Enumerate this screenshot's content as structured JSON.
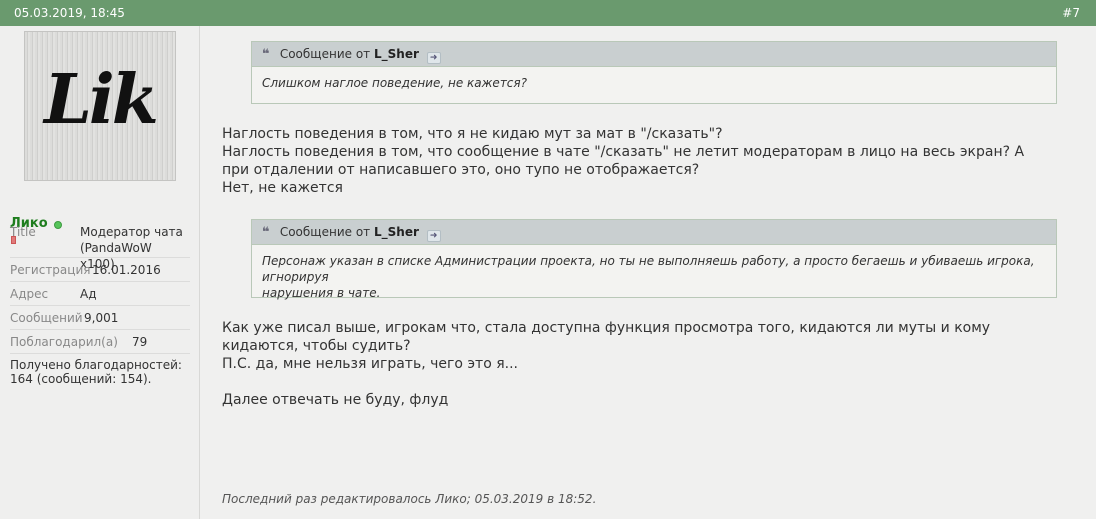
{
  "post": {
    "date": "05.03.2019, 18:45",
    "number": "#7"
  },
  "author": {
    "avatar_text": "Lik",
    "name": "Лико",
    "online": true,
    "title_label": "Title",
    "title_value_1": "Модератор чата",
    "title_value_2": "(PandaWoW x100)",
    "reg_label": "Регистрация",
    "reg_value": "16.01.2016",
    "addr_label": "Адрес",
    "addr_value": "Ад",
    "msgs_label": "Сообщений",
    "msgs_value": "9,001",
    "thanked_label": "Поблагодарил(а)",
    "thanked_value": "79",
    "thanks_line_1": "Получено благодарностей:",
    "thanks_line_2": "164 (сообщений: 154)."
  },
  "quote1": {
    "prefix": "Сообщение от",
    "author": "L_Sher",
    "text": "Слишком наглое поведение, не кажется?"
  },
  "reply1": {
    "line1": "Наглость поведения в том, что я не кидаю мут за мат в \"/сказать\"?",
    "line2": "Наглость поведения в том, что сообщение в чате \"/сказать\" не летит модераторам в лицо на весь экран? А",
    "line3": "при отдалении от написавшего это, оно тупо не отображается?",
    "line4": "Нет, не кажется"
  },
  "quote2": {
    "prefix": "Сообщение от",
    "author": "L_Sher",
    "text_line1": "Персонаж указан в списке Администрации проекта, но ты не выполняешь работу, а просто бегаешь и убиваешь игрока, игнорируя",
    "text_line2": "нарушения в чате."
  },
  "reply2": {
    "line1": "Как уже писал выше, игрокам что, стала доступна функция просмотра того, кидаются ли муты и кому",
    "line2": "кидаются, чтобы судить?",
    "line3": "П.С. да, мне нельзя играть, чего это я...",
    "line4": "Далее отвечать не буду, флуд"
  },
  "edited_note": "Последний раз редактировалось Лико; 05.03.2019 в 18:52.",
  "colors": {
    "header_bg": "#6a9a6e",
    "username": "#1e7d1e",
    "online": "#56c45a"
  },
  "icons": {
    "quote": "quote-icon",
    "view_post": "view-post-arrow-icon"
  }
}
